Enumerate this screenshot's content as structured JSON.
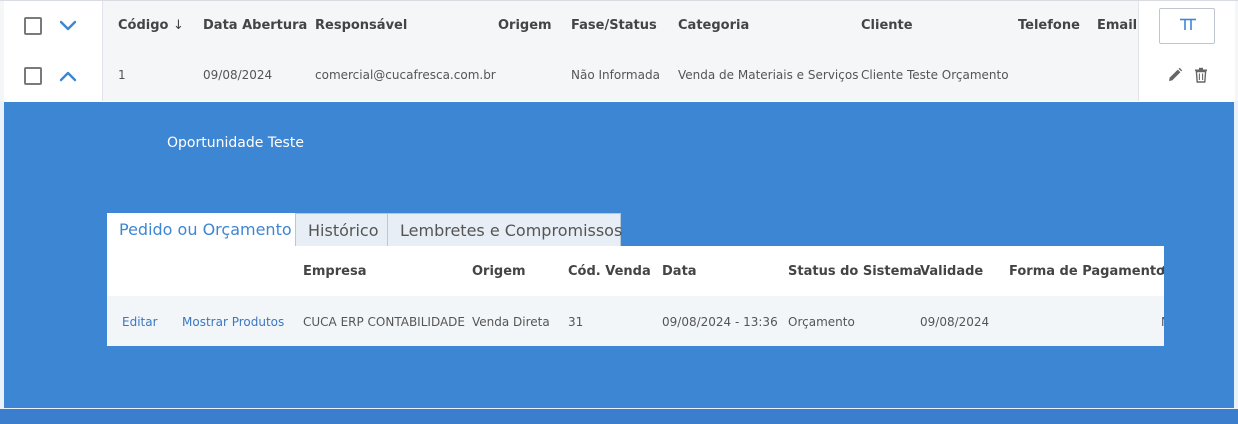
{
  "grid": {
    "columns": [
      "Código",
      "Data Abertura",
      "Responsável",
      "Origem",
      "Fase/Status",
      "Categoria",
      "Cliente",
      "Telefone",
      "Email"
    ],
    "sort_indicator": "↓",
    "rows": [
      {
        "codigo": "1",
        "data_abertura": "09/08/2024",
        "responsavel": "comercial@cucafresca.com.br",
        "origem": "",
        "fase_status": "Não Informada",
        "categoria": "Venda de Materiais e Serviços",
        "cliente": "Cliente Teste Orçamento",
        "telefone": "",
        "email": ""
      }
    ]
  },
  "detail": {
    "description": "Oportunidade Teste",
    "tabs": [
      {
        "label": "Pedido ou Orçamento",
        "active": true
      },
      {
        "label": "Histórico",
        "active": false
      },
      {
        "label": "Lembretes e Compromissos",
        "active": false
      }
    ],
    "orders_table": {
      "columns": [
        "Empresa",
        "Origem",
        "Cód. Venda",
        "Data",
        "Status do Sistema",
        "Validade",
        "Forma de Pagamento",
        "C"
      ],
      "rows": [
        {
          "action_edit": "Editar",
          "action_products": "Mostrar Produtos",
          "empresa": "CUCA ERP CONTABILIDADE",
          "origem": "Venda Direta",
          "cod_venda": "31",
          "data": "09/08/2024 - 13:36",
          "status": "Orçamento",
          "validade": "09/08/2024",
          "forma_pagamento": "",
          "extra": "N"
        }
      ]
    }
  },
  "colors": {
    "accent": "#3d86d4",
    "header_bg": "#f5f6f7",
    "link": "#3a77c2"
  },
  "icons": {
    "expand": "chevron-down-icon",
    "collapse": "chevron-up-icon",
    "edit": "pencil-icon",
    "delete": "trash-icon",
    "columns": "columns-icon"
  }
}
